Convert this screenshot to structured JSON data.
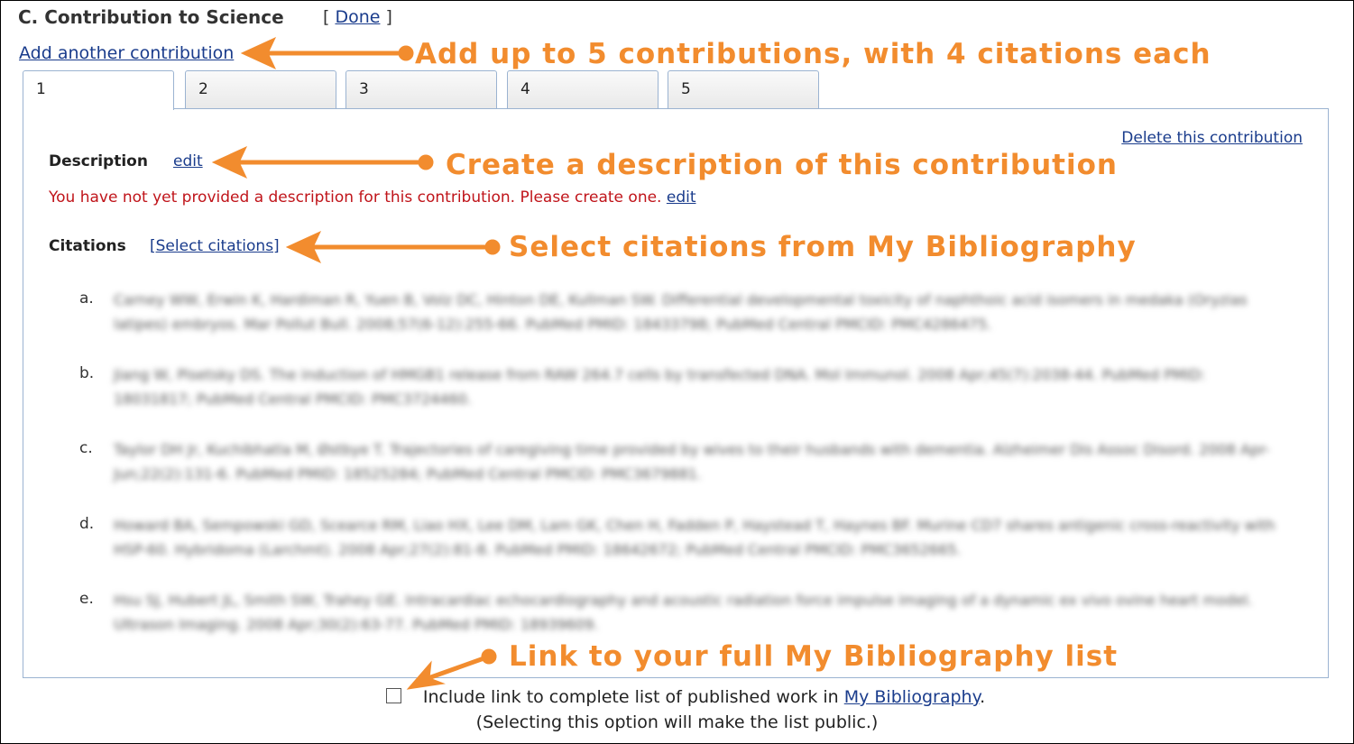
{
  "section": {
    "title": "C. Contribution to Science",
    "done_open": "[ ",
    "done_label": "Done",
    "done_close": " ]",
    "add_contribution": "Add another contribution"
  },
  "tabs": [
    "1",
    "2",
    "3",
    "4",
    "5"
  ],
  "panel": {
    "delete_label": "Delete this contribution",
    "description_label": "Description",
    "description_edit": "edit",
    "warning_text": "You have not yet provided a description for this contribution. Please create one.",
    "warning_edit": "edit",
    "citations_label": "Citations",
    "select_citations": "[Select citations]",
    "citations": [
      {
        "letter": "a.",
        "text": "Carney WW, Erwin K, Hardiman R, Yuen B, Volz DC, Hinton DE, Kullman SW. Differential developmental toxicity of naphthoic acid isomers in medaka (Oryzias latipes) embryos. Mar Pollut Bull. 2008;57(6-12):255-66. PubMed PMID: 18433798; PubMed Central PMCID: PMC4286475."
      },
      {
        "letter": "b.",
        "text": "Jiang W, Pisetsky DS. The induction of HMGB1 release from RAW 264.7 cells by transfected DNA. Mol Immunol. 2008 Apr;45(7):2038-44. PubMed PMID: 18031817; PubMed Central PMCID: PMC3724460."
      },
      {
        "letter": "c.",
        "text": "Taylor DH Jr, Kuchibhatla M, Østbye T. Trajectories of caregiving time provided by wives to their husbands with dementia. Alzheimer Dis Assoc Disord. 2008 Apr-Jun;22(2):131-6. PubMed PMID: 18525284; PubMed Central PMCID: PMC3679881."
      },
      {
        "letter": "d.",
        "text": "Howard BA, Sempowski GD, Scearce RM, Liao HX, Lee DM, Lam GK, Chen H, Fadden P, Haystead T, Haynes BF. Murine CD7 shares antigenic cross-reactivity with HSP-60. Hybridoma (Larchmt). 2008 Apr;27(2):81-8. PubMed PMID: 18642672; PubMed Central PMCID: PMC3652665."
      },
      {
        "letter": "e.",
        "text": "Hsu SJ, Hubert JL, Smith SW, Trahey GE. Intracardiac echocardiography and acoustic radiation force impulse imaging of a dynamic ex vivo ovine heart model. Ultrason Imaging. 2008 Apr;30(2):63-77. PubMed PMID: 18939609."
      }
    ]
  },
  "callouts": {
    "add": "Add up to 5 contributions, with 4 citations each",
    "describe": "Create a description of this contribution",
    "select": "Select citations from My Bibliography",
    "link": "Link to your full My Bibliography list"
  },
  "footer": {
    "include_text": "Include link to complete list of published work in ",
    "bibliography_link": "My Bibliography",
    "period": ".",
    "note": "(Selecting this option will make the list public.)"
  },
  "colors": {
    "callout": "#f28c2e",
    "link": "#1a3c8c",
    "warning": "#c0141a",
    "panel_border": "#9bb3d1"
  }
}
